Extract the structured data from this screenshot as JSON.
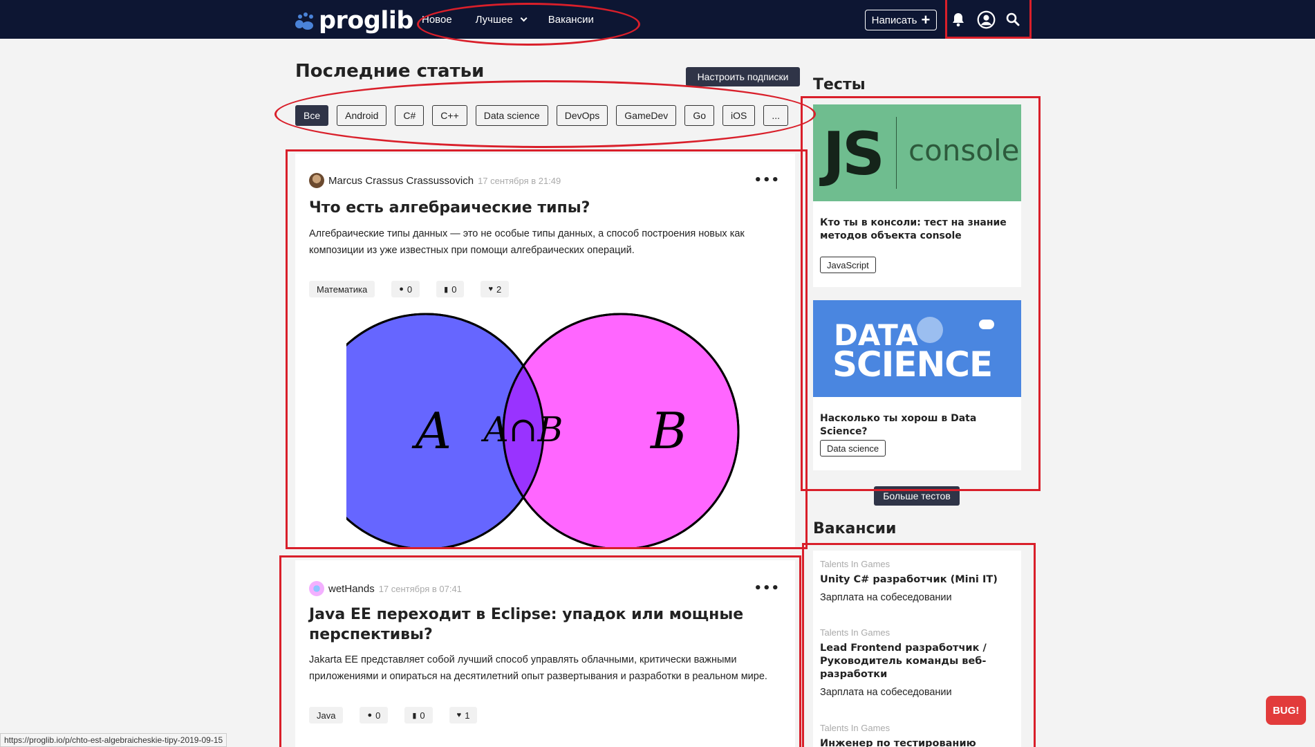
{
  "header": {
    "logo_text": "proglib",
    "nav": [
      {
        "label": "Новое"
      },
      {
        "label": "Лучшее"
      },
      {
        "label": "Вакансии"
      }
    ],
    "write_label": "Написать",
    "icons": [
      "bell-icon",
      "user-circle-icon",
      "search-icon"
    ],
    "bg_color": "#0d1633"
  },
  "main": {
    "title": "Последние статьи",
    "subscriptions_label": "Настроить подписки",
    "tags": [
      "Все",
      "Android",
      "C#",
      "C++",
      "Data science",
      "DevOps",
      "GameDev",
      "Go",
      "iOS",
      "..."
    ],
    "active_tag": "Все",
    "posts": [
      {
        "author": "Marcus Crassus Crassussovich",
        "date": "17 сентября в 21:49",
        "title": "Что есть алгебраические типы?",
        "description": "Алгебраические типы данных — это не особые типы данных, а способ построения новых как композиции из уже известных при помощи алгебраических операций.",
        "tag": "Математика",
        "comments": "0",
        "bookmarks": "0",
        "likes": "2",
        "image": {
          "label_a": "A",
          "label_ab": "A∩B",
          "label_b": "B",
          "color_a": "#6666ff",
          "color_b": "#ff66ff",
          "color_ab": "#9933ff"
        }
      },
      {
        "author": "wetHands",
        "date": "17 сентября в 07:41",
        "title": "Java EE переходит в Eclipse: упадок или мощные перспективы?",
        "description": "Jakarta EE представляет собой лучший способ управлять облачными, критически важными приложениями и опираться на десятилетний опыт развертывания и разработки в реальном мире.",
        "tag": "Java",
        "comments": "0",
        "bookmarks": "0",
        "likes": "1"
      }
    ]
  },
  "sidebar": {
    "tests_title": "Тесты",
    "tests": [
      {
        "image_text_left": "JS",
        "image_text_right": "console",
        "image_color": "#6fbd8f",
        "name": "Кто ты в консоли: тест на знание методов объекта console",
        "tag": "JavaScript"
      },
      {
        "image_text_top": "DATA",
        "image_text_bottom": "SCIENCE",
        "image_color": "#4a86e0",
        "name": "Насколько ты хорош в Data Science?",
        "tag": "Data science"
      }
    ],
    "more_tests_label": "Больше тестов",
    "jobs_title": "Вакансии",
    "jobs": [
      {
        "company": "Talents In Games",
        "title": "Unity C# разработчик (Mini IT)",
        "salary": "Зарплата на собеседовании"
      },
      {
        "company": "Talents In Games",
        "title": "Lead Frontend разработчик / Руководитель команды веб-разработки",
        "salary": "Зарплата на собеседовании"
      },
      {
        "company": "Talents In Games",
        "title": "Инженер по тестированию",
        "salary": ""
      }
    ]
  },
  "bug_label": "BUG!",
  "status_url": "https://proglib.io/p/chto-est-algebraicheskie-tipy-2019-09-15",
  "annotation_color": "#d91f2a"
}
